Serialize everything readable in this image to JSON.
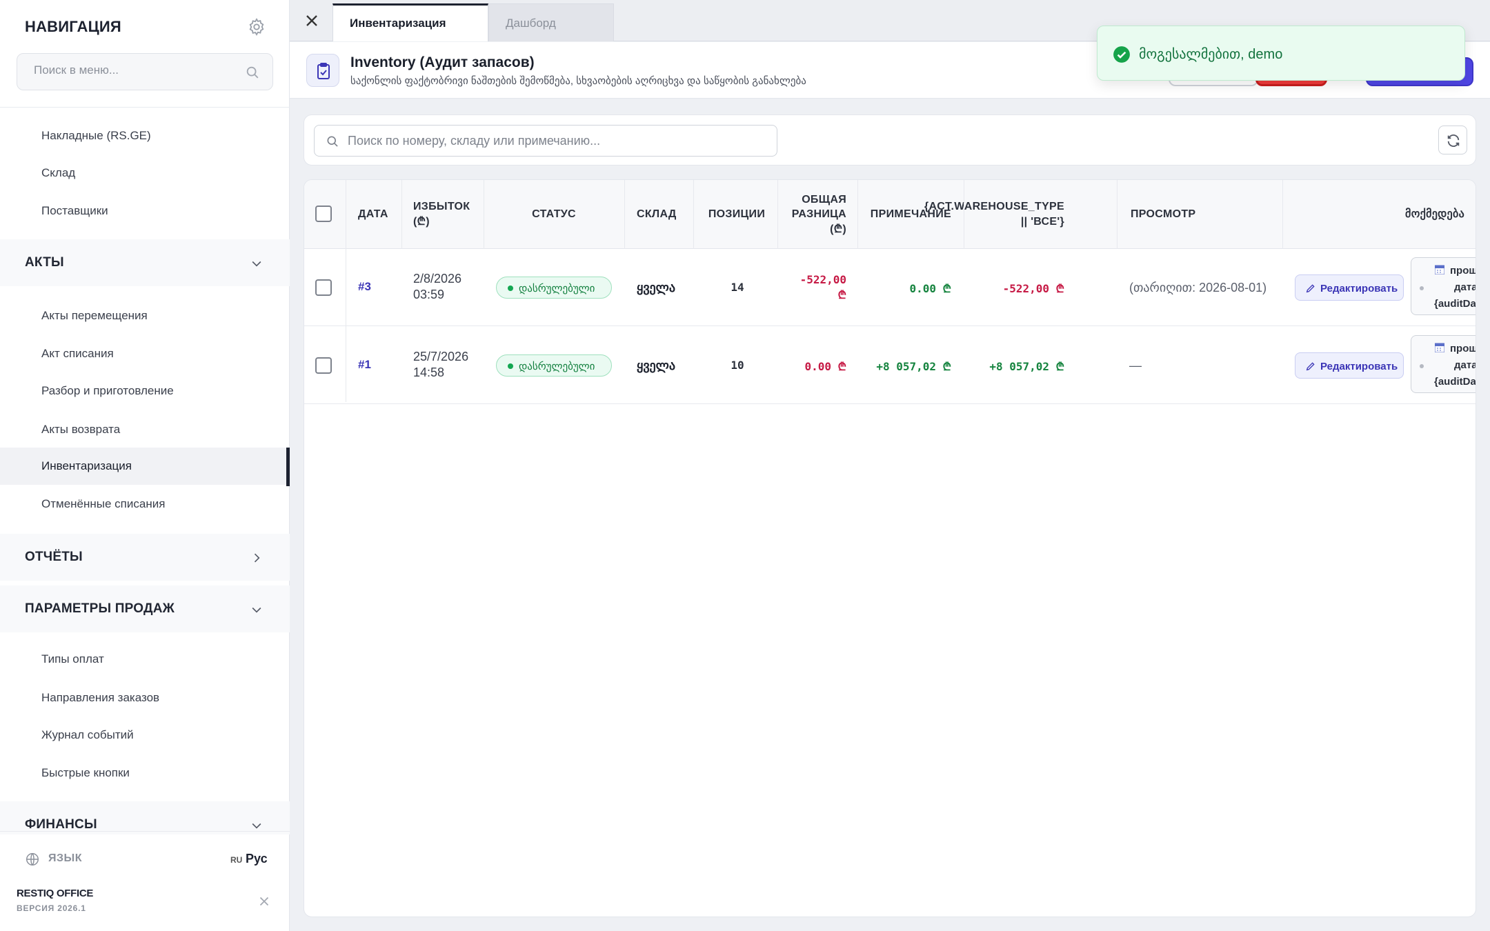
{
  "sidebar": {
    "title": "НАВИГАЦИЯ",
    "search_placeholder": "Поиск в меню...",
    "items_top": [
      "Накладные (RS.GE)",
      "Склад",
      "Поставщики"
    ],
    "section_acts": "АКТЫ",
    "items_acts": [
      "Акты перемещения",
      "Акт списания",
      "Разбор и приготовление",
      "Акты возврата",
      "Инвентаризация",
      "Отменённые списания"
    ],
    "active_item": "Инвентаризация",
    "section_reports": "ОТЧЁТЫ",
    "section_sales": "ПАРАМЕТРЫ ПРОДАЖ",
    "items_sales": [
      "Типы оплат",
      "Направления заказов",
      "Журнал событий",
      "Быстрые кнопки"
    ],
    "section_finance": "ФИНАНСЫ",
    "lang_label": "ЯЗЫК",
    "lang_code": "RU",
    "lang_value": "Рус",
    "brand": "RESTIQ OFFICE",
    "version": "ВЕРСИЯ 2026.1"
  },
  "tabs": [
    {
      "label": "Инвентаризация",
      "active": true
    },
    {
      "label": "Дашборд",
      "active": false
    }
  ],
  "header": {
    "title": "Inventory (Аудит запасов)",
    "subtitle": "საქონლის ფაქტობრივი ნაშთების შემოწმება, სხვაობების აღრიცხვა და საწყობის განახლება"
  },
  "toast": {
    "message": "მოგესალმებით, demo",
    "color": "#12723d"
  },
  "search": {
    "placeholder": "Поиск по номеру, складу или примечанию..."
  },
  "table": {
    "columns": {
      "date": "ДАТА",
      "surplus_l1": "ИЗБЫТОК",
      "surplus_l2": "(₾)",
      "status": "СТАТУС",
      "warehouse": "СКЛАД",
      "positions": "ПОЗИЦИИ",
      "diff_l1": "ОБЩАЯ",
      "diff_l2": "РАЗНИЦА",
      "diff_l3": "(₾)",
      "note": "ПРИМЕЧАНИЕ",
      "wt_l1": "{ACT.WAREHOUSE_TYPE",
      "wt_l2": "|| 'ВСЕ'}",
      "view": "ПРОСМОТР",
      "actions": "მოქმედება"
    },
    "rows": [
      {
        "number": "#3",
        "date_l1": "2/8/2026",
        "date_l2": "03:59",
        "status": "დასრულებული",
        "warehouse": "ყველა",
        "positions": "14",
        "surplus_l1": "-522,00",
        "surplus_l2": "₾",
        "diff": "0.00 ₾",
        "note": "-522,00 ₾",
        "view": "(თარიღით: 2026-08-01)",
        "edit_label": "Редактировать",
        "action_l1": "прош",
        "action_l2": "дата",
        "action_l3": "{auditDa"
      },
      {
        "number": "#1",
        "date_l1": "25/7/2026",
        "date_l2": "14:58",
        "status": "დასრულებული",
        "warehouse": "ყველა",
        "positions": "10",
        "surplus": "0.00 ₾",
        "diff": "+8 057,02 ₾",
        "note": "+8 057,02 ₾",
        "view": "—",
        "edit_label": "Редактировать",
        "action_l1": "прош",
        "action_l2": "дата",
        "action_l3": "{auditDa"
      }
    ]
  }
}
